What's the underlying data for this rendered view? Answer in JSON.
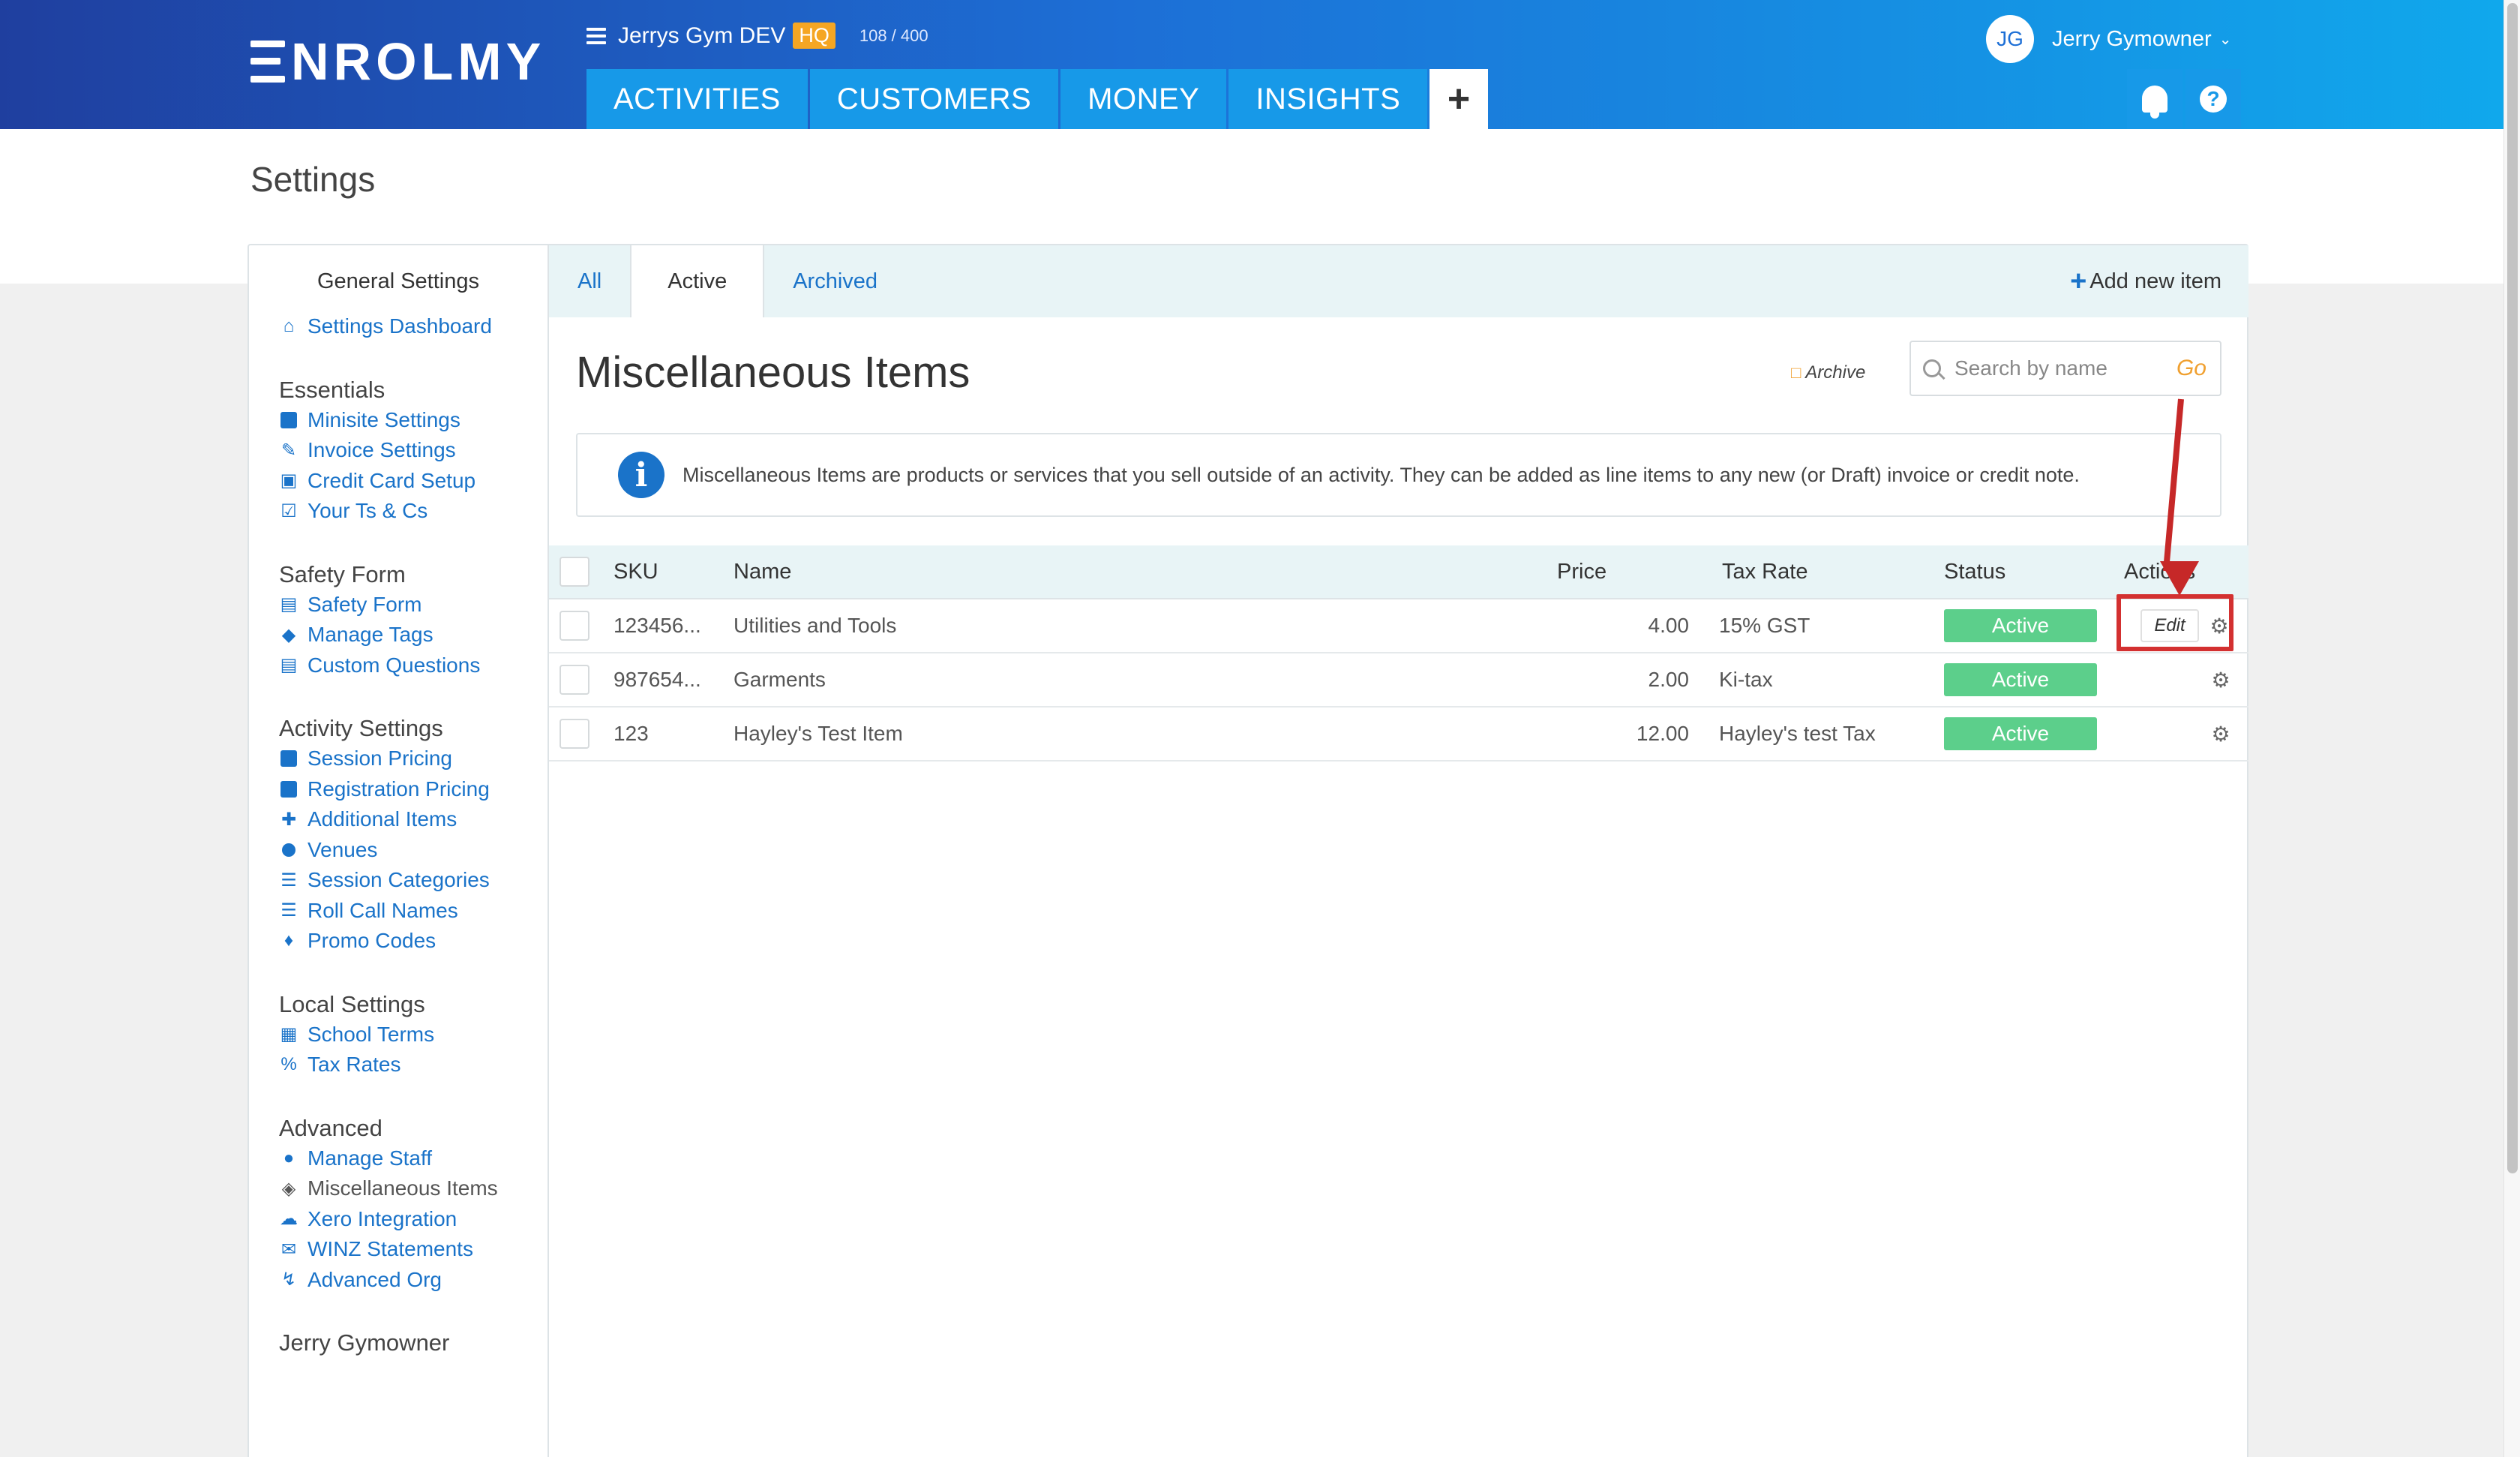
{
  "header": {
    "logo": "ENROLMY",
    "org_name": "Jerrys Gym DEV",
    "org_badge": "HQ",
    "quota": "108 / 400",
    "nav": [
      "ACTIVITIES",
      "CUSTOMERS",
      "MONEY",
      "INSIGHTS"
    ],
    "add_icon": "plus-icon",
    "user_initials": "JG",
    "user_name": "Jerry Gymowner",
    "bell_icon": "bell-icon",
    "help_icon": "question-icon"
  },
  "page": {
    "title": "Settings"
  },
  "sidebar": {
    "heading": "General Settings",
    "dashboard": "Settings Dashboard",
    "sections": [
      {
        "title": "Essentials",
        "items": [
          "Minisite Settings",
          "Invoice Settings",
          "Credit Card Setup",
          "Your Ts & Cs"
        ]
      },
      {
        "title": "Safety Form",
        "items": [
          "Safety Form",
          "Manage Tags",
          "Custom Questions"
        ]
      },
      {
        "title": "Activity Settings",
        "items": [
          "Session Pricing",
          "Registration Pricing",
          "Additional Items",
          "Venues",
          "Session Categories",
          "Roll Call Names",
          "Promo Codes"
        ]
      },
      {
        "title": "Local Settings",
        "items": [
          "School Terms",
          "Tax Rates"
        ]
      },
      {
        "title": "Advanced",
        "items": [
          "Manage Staff",
          "Miscellaneous Items",
          "Xero Integration",
          "WINZ Statements",
          "Advanced Org"
        ]
      },
      {
        "title": "Jerry Gymowner",
        "items": []
      }
    ],
    "active_item": "Miscellaneous Items"
  },
  "tabs": {
    "all": "All",
    "active": "Active",
    "archived": "Archived",
    "add_new": "Add new item"
  },
  "content": {
    "title": "Miscellaneous Items",
    "archive_link": "Archive",
    "search_placeholder": "Search by name",
    "search_go": "Go",
    "info_text": "Miscellaneous Items are products or services that you sell outside of an activity. They can be added as line items to any new (or Draft) invoice or credit note."
  },
  "table": {
    "columns": {
      "sku": "SKU",
      "name": "Name",
      "price": "Price",
      "tax_rate": "Tax Rate",
      "status": "Status",
      "actions": "Actions"
    },
    "rows": [
      {
        "sku": "123456...",
        "name": "Utilities and Tools",
        "price": "4.00",
        "tax_rate": "15% GST",
        "status": "Active",
        "edit": "Edit"
      },
      {
        "sku": "987654...",
        "name": "Garments",
        "price": "2.00",
        "tax_rate": "Ki-tax",
        "status": "Active"
      },
      {
        "sku": "123",
        "name": "Hayley's Test Item",
        "price": "12.00",
        "tax_rate": "Hayley's test Tax",
        "status": "Active"
      }
    ]
  },
  "colors": {
    "accent": "#1a73c9",
    "header_start": "#1f3f9f",
    "header_end": "#10a8ec",
    "badge_hq": "#f5a623",
    "status_active": "#5ccf8b",
    "annotation": "#d33030"
  }
}
